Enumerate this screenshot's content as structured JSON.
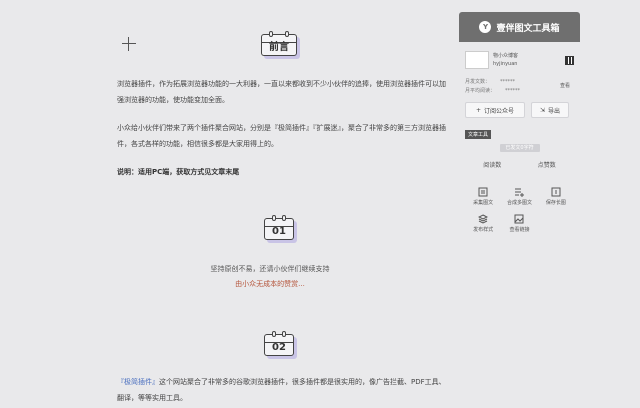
{
  "article": {
    "preface_label": "前言",
    "para1": "浏览器插件，作为拓展浏览器功能的一大利器，一直以来都收到不少小伙伴的追捧，使用浏览器插件可以加强浏览器的功能，使功能变加全面。",
    "para2": "小众给小伙伴们带来了两个插件聚合网站，分别是『极简插件』『扩展迷』，聚合了非常多的第三方浏览器插件，各式各样的功能，相信很多都是大家用得上的。",
    "note": "说明：适用PC端，获取方式见文章末尾",
    "sec1_label": "01",
    "support_text": "坚持原创不易，还请小伙伴们继续支持",
    "support_sub": "由小众无成本的赞赏...",
    "sec2_label": "02",
    "para3_link": "『极简插件』",
    "para3": "这个网站聚合了非常多的谷歌浏览器插件，很多插件都是很实用的，像广告拦截、PDF工具、翻译，等等实用工具。"
  },
  "sidebar": {
    "title": "壹伴图文工具箱",
    "account_name": "物小众博客",
    "account_id": "hyjinyuan",
    "stat1_label": "月发文数：",
    "stat1_value": "******",
    "stat2_label": "月平均阅读：",
    "stat2_value": "******",
    "view_label": "查看",
    "subscribe_label": "订阅公众号",
    "export_label": "导出",
    "tools_tag": "文章工具",
    "word_badge": "已发文0字符",
    "count1": "阅读数",
    "count2": "点赞数",
    "tools": [
      "采集图文",
      "合成多图文",
      "保存长图",
      "发布样式",
      "查看链接"
    ]
  }
}
